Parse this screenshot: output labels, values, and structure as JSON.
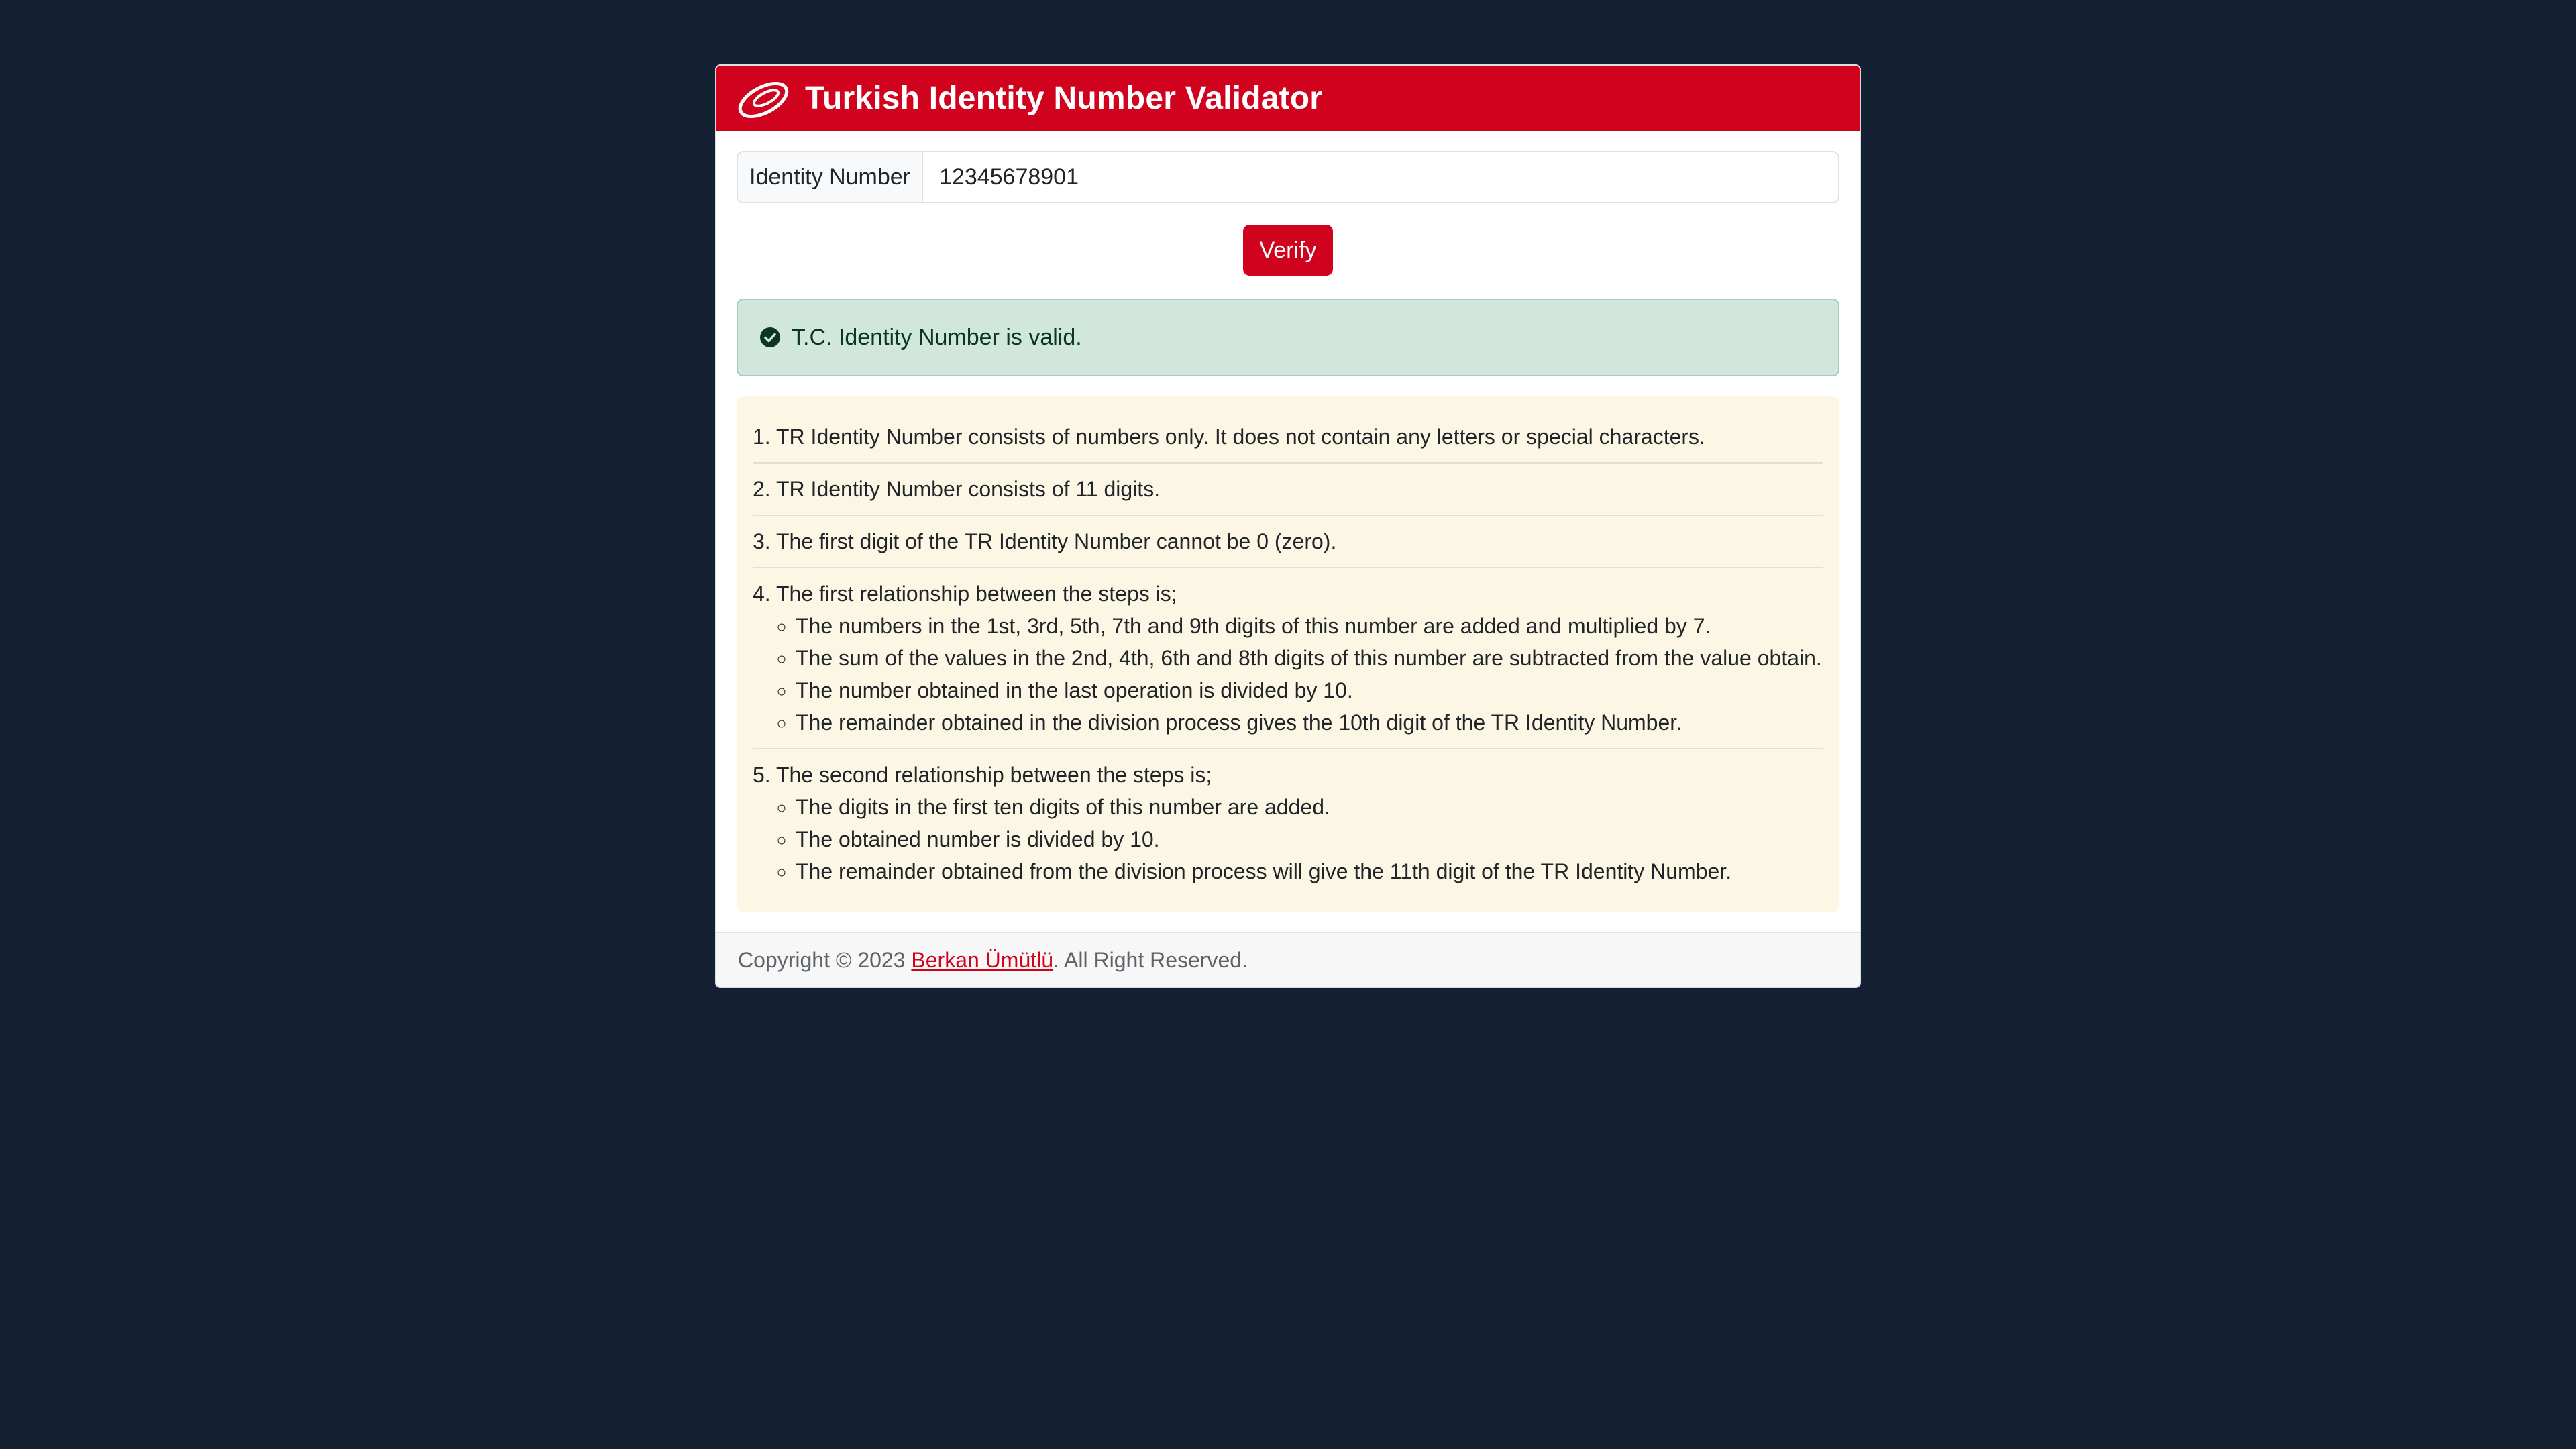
{
  "header": {
    "title": "Turkish Identity Number Validator",
    "logo_icon": "turkish-crescent-logo-icon",
    "brand_color": "#d0021e"
  },
  "form": {
    "input_label": "Identity Number",
    "input_value": "12345678901",
    "verify_label": "Verify"
  },
  "alert": {
    "icon": "check-circle-icon",
    "message": "T.C. Identity Number is valid.",
    "status_color": "#0a3622"
  },
  "rules": [
    {
      "text": "1. TR Identity Number consists of numbers only. It does not contain any letters or special characters."
    },
    {
      "text": "2. TR Identity Number consists of 11 digits."
    },
    {
      "text": "3. The first digit of the TR Identity Number cannot be 0 (zero)."
    },
    {
      "text": "4. The first relationship between the steps is;",
      "sub": [
        "The numbers in the 1st, 3rd, 5th, 7th and 9th digits of this number are added and multiplied by 7.",
        "The sum of the values in the 2nd, 4th, 6th and 8th digits of this number are subtracted from the value obtain.",
        "The number obtained in the last operation is divided by 10.",
        "The remainder obtained in the division process gives the 10th digit of the TR Identity Number."
      ]
    },
    {
      "text": "5. The second relationship between the steps is;",
      "sub": [
        "The digits in the first ten digits of this number are added.",
        "The obtained number is divided by 10.",
        "The remainder obtained from the division process will give the 11th digit of the TR Identity Number."
      ]
    }
  ],
  "footer": {
    "prefix": "Copyright © 2023 ",
    "author_link": "Berkan Ümütlü",
    "suffix": ". All Right Reserved."
  }
}
